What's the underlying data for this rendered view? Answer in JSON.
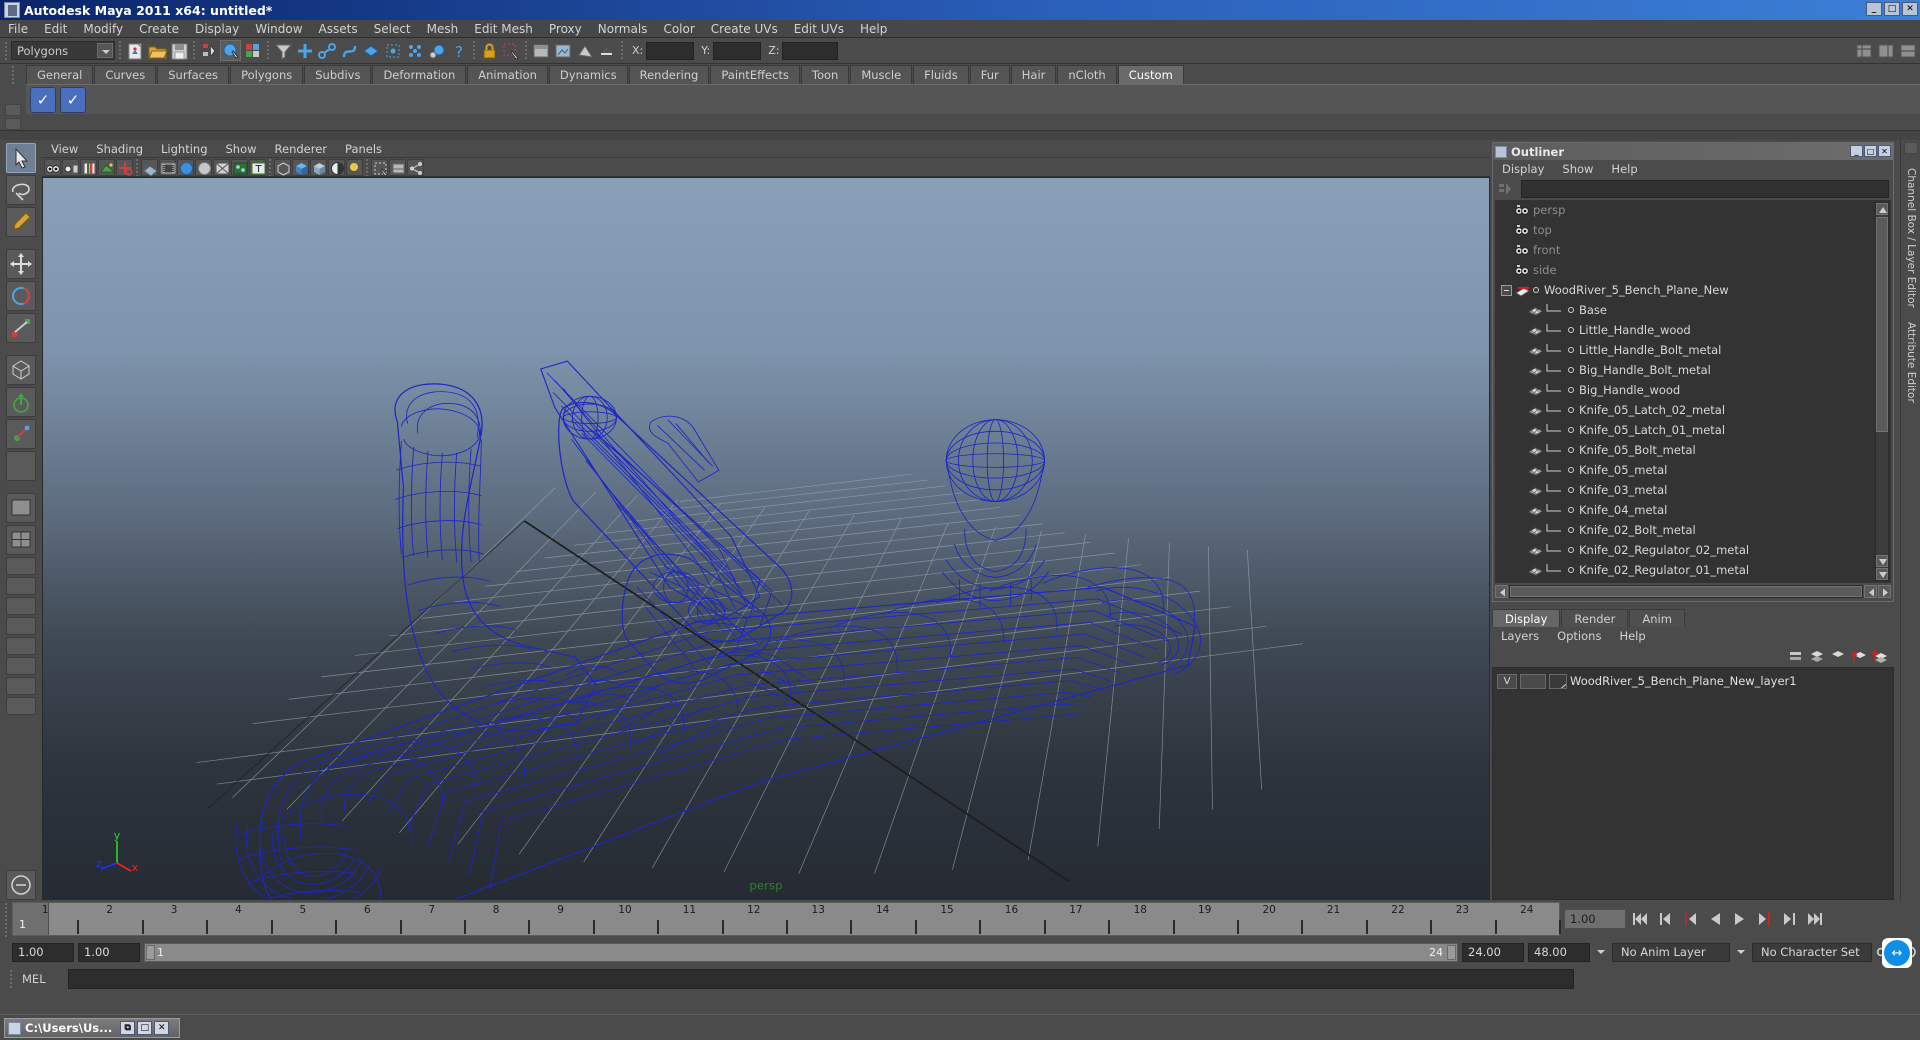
{
  "window": {
    "title": "Autodesk Maya 2011 x64: untitled*",
    "icon": "maya-icon",
    "minimize": "_",
    "maximize": "□",
    "close": "✕"
  },
  "menubar": {
    "items": [
      "File",
      "Edit",
      "Modify",
      "Create",
      "Display",
      "Window",
      "Assets",
      "Select",
      "Mesh",
      "Edit Mesh",
      "Proxy",
      "Normals",
      "Color",
      "Create UVs",
      "Edit UVs",
      "Help"
    ]
  },
  "statusline": {
    "menuset": "Polygons",
    "x_label": "X:",
    "y_label": "Y:",
    "z_label": "Z:",
    "x_value": "",
    "y_value": "",
    "z_value": ""
  },
  "shelf": {
    "tabs": [
      "General",
      "Curves",
      "Surfaces",
      "Polygons",
      "Subdivs",
      "Deformation",
      "Animation",
      "Dynamics",
      "Rendering",
      "PaintEffects",
      "Toon",
      "Muscle",
      "Fluids",
      "Fur",
      "Hair",
      "nCloth",
      "Custom"
    ],
    "active_tab": "Custom",
    "buttons": [
      "checkmark-blue-1",
      "checkmark-blue-2"
    ]
  },
  "viewport": {
    "menus": [
      "View",
      "Shading",
      "Lighting",
      "Show",
      "Renderer",
      "Panels"
    ],
    "camera_label": "persp",
    "axis": {
      "x": "x",
      "y": "y",
      "z": "z"
    }
  },
  "outliner": {
    "title": "Outliner",
    "menus": [
      "Display",
      "Show",
      "Help"
    ],
    "search_value": "",
    "items": [
      {
        "label": "persp",
        "type": "camera",
        "dim": true,
        "child": false
      },
      {
        "label": "top",
        "type": "camera",
        "dim": true,
        "child": false
      },
      {
        "label": "front",
        "type": "camera",
        "dim": true,
        "child": false
      },
      {
        "label": "side",
        "type": "camera",
        "dim": true,
        "child": false
      },
      {
        "label": "WoodRiver_5_Bench_Plane_New",
        "type": "group",
        "dim": false,
        "child": false,
        "expanded": true
      },
      {
        "label": "Base",
        "type": "mesh",
        "dim": false,
        "child": true
      },
      {
        "label": "Little_Handle_wood",
        "type": "mesh",
        "dim": false,
        "child": true
      },
      {
        "label": "Little_Handle_Bolt_metal",
        "type": "mesh",
        "dim": false,
        "child": true
      },
      {
        "label": "Big_Handle_Bolt_metal",
        "type": "mesh",
        "dim": false,
        "child": true
      },
      {
        "label": "Big_Handle_wood",
        "type": "mesh",
        "dim": false,
        "child": true
      },
      {
        "label": "Knife_05_Latch_02_metal",
        "type": "mesh",
        "dim": false,
        "child": true
      },
      {
        "label": "Knife_05_Latch_01_metal",
        "type": "mesh",
        "dim": false,
        "child": true
      },
      {
        "label": "Knife_05_Bolt_metal",
        "type": "mesh",
        "dim": false,
        "child": true
      },
      {
        "label": "Knife_05_metal",
        "type": "mesh",
        "dim": false,
        "child": true
      },
      {
        "label": "Knife_03_metal",
        "type": "mesh",
        "dim": false,
        "child": true
      },
      {
        "label": "Knife_04_metal",
        "type": "mesh",
        "dim": false,
        "child": true
      },
      {
        "label": "Knife_02_Bolt_metal",
        "type": "mesh",
        "dim": false,
        "child": true
      },
      {
        "label": "Knife_02_Regulator_02_metal",
        "type": "mesh",
        "dim": false,
        "child": true
      },
      {
        "label": "Knife_02_Regulator_01_metal",
        "type": "mesh",
        "dim": false,
        "child": true
      }
    ]
  },
  "layer_editor": {
    "tabs": [
      "Display",
      "Render",
      "Anim"
    ],
    "active_tab": "Display",
    "menus": [
      "Layers",
      "Options",
      "Help"
    ],
    "layers": [
      {
        "visibility": "V",
        "mode": "",
        "name": "WoodRiver_5_Bench_Plane_New_layer1"
      }
    ]
  },
  "right_rail": {
    "labels": [
      "Channel Box / Layer Editor",
      "Attribute Editor"
    ]
  },
  "timeline": {
    "ticks": [
      "1",
      "2",
      "3",
      "4",
      "5",
      "6",
      "7",
      "8",
      "9",
      "10",
      "11",
      "12",
      "13",
      "14",
      "15",
      "16",
      "17",
      "18",
      "19",
      "20",
      "21",
      "22",
      "23",
      "24"
    ],
    "current_frame": "1",
    "current_field": "1.00",
    "playback_buttons": [
      "go-to-start",
      "step-back-key",
      "step-back-frame",
      "play-backwards",
      "play-forwards",
      "step-forward-frame",
      "step-forward-key",
      "go-to-end"
    ]
  },
  "range_slider": {
    "anim_start": "1.00",
    "range_start": "1.00",
    "bar_start": "1",
    "bar_end": "24",
    "range_end": "24.00",
    "anim_end": "48.00",
    "anim_layer": "No Anim Layer",
    "character_set": "No Character Set"
  },
  "command_line": {
    "language": "MEL",
    "value": ""
  },
  "taskbar": {
    "item_title": "C:\\Users\\Us...",
    "restore": "⧉",
    "maximize": "□",
    "close": "✕"
  },
  "colors": {
    "wireframe": "#1a28c8",
    "title_blue": "#0a246a",
    "panel_bg": "#4b4b4b",
    "viewport_top": "#8aa0b8",
    "viewport_bottom": "#262b33",
    "axis_x": "#ff2020",
    "axis_y": "#20dd20",
    "axis_z": "#2030ff",
    "camera_label": "#2f7e2f"
  }
}
